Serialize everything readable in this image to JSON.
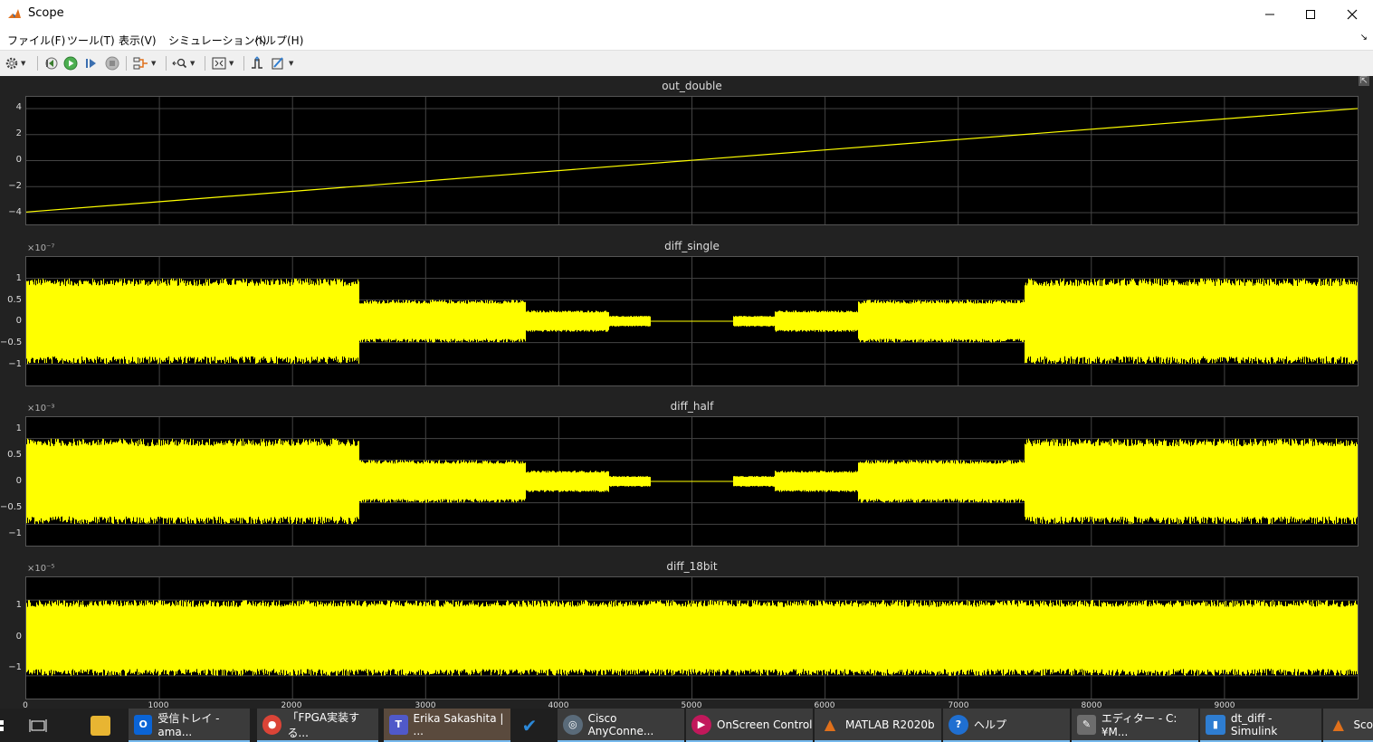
{
  "window": {
    "title": "Scope",
    "minimize_icon": "minimize-icon",
    "maximize_icon": "maximize-icon",
    "close_icon": "close-icon"
  },
  "menu": {
    "items": [
      "ファイル(F)",
      "ツール(T)",
      "表示(V)",
      "シミュレーション(I)",
      "ヘルプ(H)"
    ],
    "undock_icon": "undock-arrow-icon"
  },
  "toolbar": {
    "icons": [
      "settings-gear-icon",
      "step-back-icon",
      "run-icon",
      "step-forward-icon",
      "stop-icon",
      "highlight-signal-icon",
      "zoom-icon",
      "autoscale-icon",
      "triggers-icon",
      "cursor-measurements-icon"
    ]
  },
  "plots": [
    {
      "title": "out_double",
      "exponent": "",
      "yticks": [
        "4",
        "2",
        "0",
        "−2",
        "−4"
      ],
      "ylim": [
        -4.9,
        4.9
      ]
    },
    {
      "title": "diff_single",
      "exponent": "×10⁻⁷",
      "yticks": [
        "1",
        "0.5",
        "0",
        "−0.5",
        "−1"
      ],
      "ylim": [
        -1.5,
        1.5
      ]
    },
    {
      "title": "diff_half",
      "exponent": "×10⁻³",
      "yticks": [
        "1",
        "0.5",
        "0",
        "−0.5",
        "−1"
      ],
      "ylim": [
        -1.5,
        1.5
      ]
    },
    {
      "title": "diff_18bit",
      "exponent": "×10⁻⁵",
      "yticks": [
        "1",
        "0",
        "−1"
      ],
      "ylim": [
        -1.6,
        1.6
      ]
    }
  ],
  "xaxis": {
    "ticks": [
      "0",
      "1000",
      "2000",
      "3000",
      "4000",
      "5000",
      "6000",
      "7000",
      "8000",
      "9000"
    ],
    "xlim": [
      0,
      10000
    ]
  },
  "chart_data": [
    {
      "type": "line",
      "title": "out_double",
      "x": [
        0,
        10000
      ],
      "series": [
        {
          "values": [
            -3.95,
            4.0
          ]
        }
      ],
      "xlim": [
        0,
        10000
      ],
      "ylim": [
        -4.9,
        4.9
      ],
      "grid": true,
      "color": "#ffff00"
    },
    {
      "type": "area",
      "title": "diff_single",
      "exponent": "1e-7",
      "segments": [
        {
          "x0": 0,
          "x1": 2500,
          "amplitude": 1.0
        },
        {
          "x0": 2500,
          "x1": 3750,
          "amplitude": 0.5
        },
        {
          "x0": 3750,
          "x1": 4375,
          "amplitude": 0.25
        },
        {
          "x0": 4375,
          "x1": 4690,
          "amplitude": 0.125
        },
        {
          "x0": 4690,
          "x1": 5000,
          "amplitude": 0.0
        },
        {
          "x0": 5000,
          "x1": 5310,
          "amplitude": 0.0
        },
        {
          "x0": 5310,
          "x1": 5625,
          "amplitude": 0.125
        },
        {
          "x0": 5625,
          "x1": 6250,
          "amplitude": 0.25
        },
        {
          "x0": 6250,
          "x1": 7500,
          "amplitude": 0.5
        },
        {
          "x0": 7500,
          "x1": 10000,
          "amplitude": 1.0
        }
      ],
      "xlim": [
        0,
        10000
      ],
      "ylim": [
        -1.5,
        1.5
      ],
      "grid": true,
      "color": "#ffff00"
    },
    {
      "type": "area",
      "title": "diff_half",
      "exponent": "1e-3",
      "segments": [
        {
          "x0": 0,
          "x1": 2500,
          "amplitude": 1.0
        },
        {
          "x0": 2500,
          "x1": 3750,
          "amplitude": 0.5
        },
        {
          "x0": 3750,
          "x1": 4375,
          "amplitude": 0.25
        },
        {
          "x0": 4375,
          "x1": 4690,
          "amplitude": 0.125
        },
        {
          "x0": 4690,
          "x1": 5000,
          "amplitude": 0.0
        },
        {
          "x0": 5000,
          "x1": 5310,
          "amplitude": 0.0
        },
        {
          "x0": 5310,
          "x1": 5625,
          "amplitude": 0.125
        },
        {
          "x0": 5625,
          "x1": 6250,
          "amplitude": 0.25
        },
        {
          "x0": 6250,
          "x1": 7500,
          "amplitude": 0.5
        },
        {
          "x0": 7500,
          "x1": 10000,
          "amplitude": 1.0
        }
      ],
      "xlim": [
        0,
        10000
      ],
      "ylim": [
        -1.5,
        1.5
      ],
      "grid": true,
      "color": "#ffff00"
    },
    {
      "type": "area",
      "title": "diff_18bit",
      "exponent": "1e-5",
      "segments": [
        {
          "x0": 0,
          "x1": 10000,
          "amplitude": 1.0
        }
      ],
      "xlim": [
        0,
        10000
      ],
      "ylim": [
        -1.6,
        1.6
      ],
      "grid": true,
      "color": "#ffff00"
    }
  ],
  "taskbar": {
    "items": [
      {
        "label": "",
        "icon": "task-view-icon"
      },
      {
        "label": "",
        "icon": "file-explorer-icon",
        "color": "#e8b532"
      },
      {
        "label": "受信トレイ - ama...",
        "icon": "outlook-icon",
        "color": "#0a64d6"
      },
      {
        "label": "「FPGA実装する...",
        "icon": "chrome-icon",
        "color": "#db4437"
      },
      {
        "label": "Erika Sakashita | ...",
        "icon": "teams-icon",
        "color": "#5059c9"
      },
      {
        "label": "",
        "icon": "todo-check-icon",
        "color": "#2b88d8"
      },
      {
        "label": "Cisco AnyConne...",
        "icon": "cisco-anyconnect-icon",
        "color": "#5a6b7a"
      },
      {
        "label": "OnScreen Control",
        "icon": "onscreen-control-icon",
        "color": "#c2185b"
      },
      {
        "label": "MATLAB R2020b",
        "icon": "matlab-icon",
        "color": "#e0701b"
      },
      {
        "label": "ヘルプ",
        "icon": "help-icon",
        "color": "#1f6fd1"
      },
      {
        "label": "エディター - C:¥M...",
        "icon": "editor-icon",
        "color": "#6d6d6d"
      },
      {
        "label": "dt_diff - Simulink",
        "icon": "simulink-icon",
        "color": "#2e7dd1"
      },
      {
        "label": "Sco",
        "icon": "scope-icon",
        "color": "#e0701b"
      }
    ]
  }
}
